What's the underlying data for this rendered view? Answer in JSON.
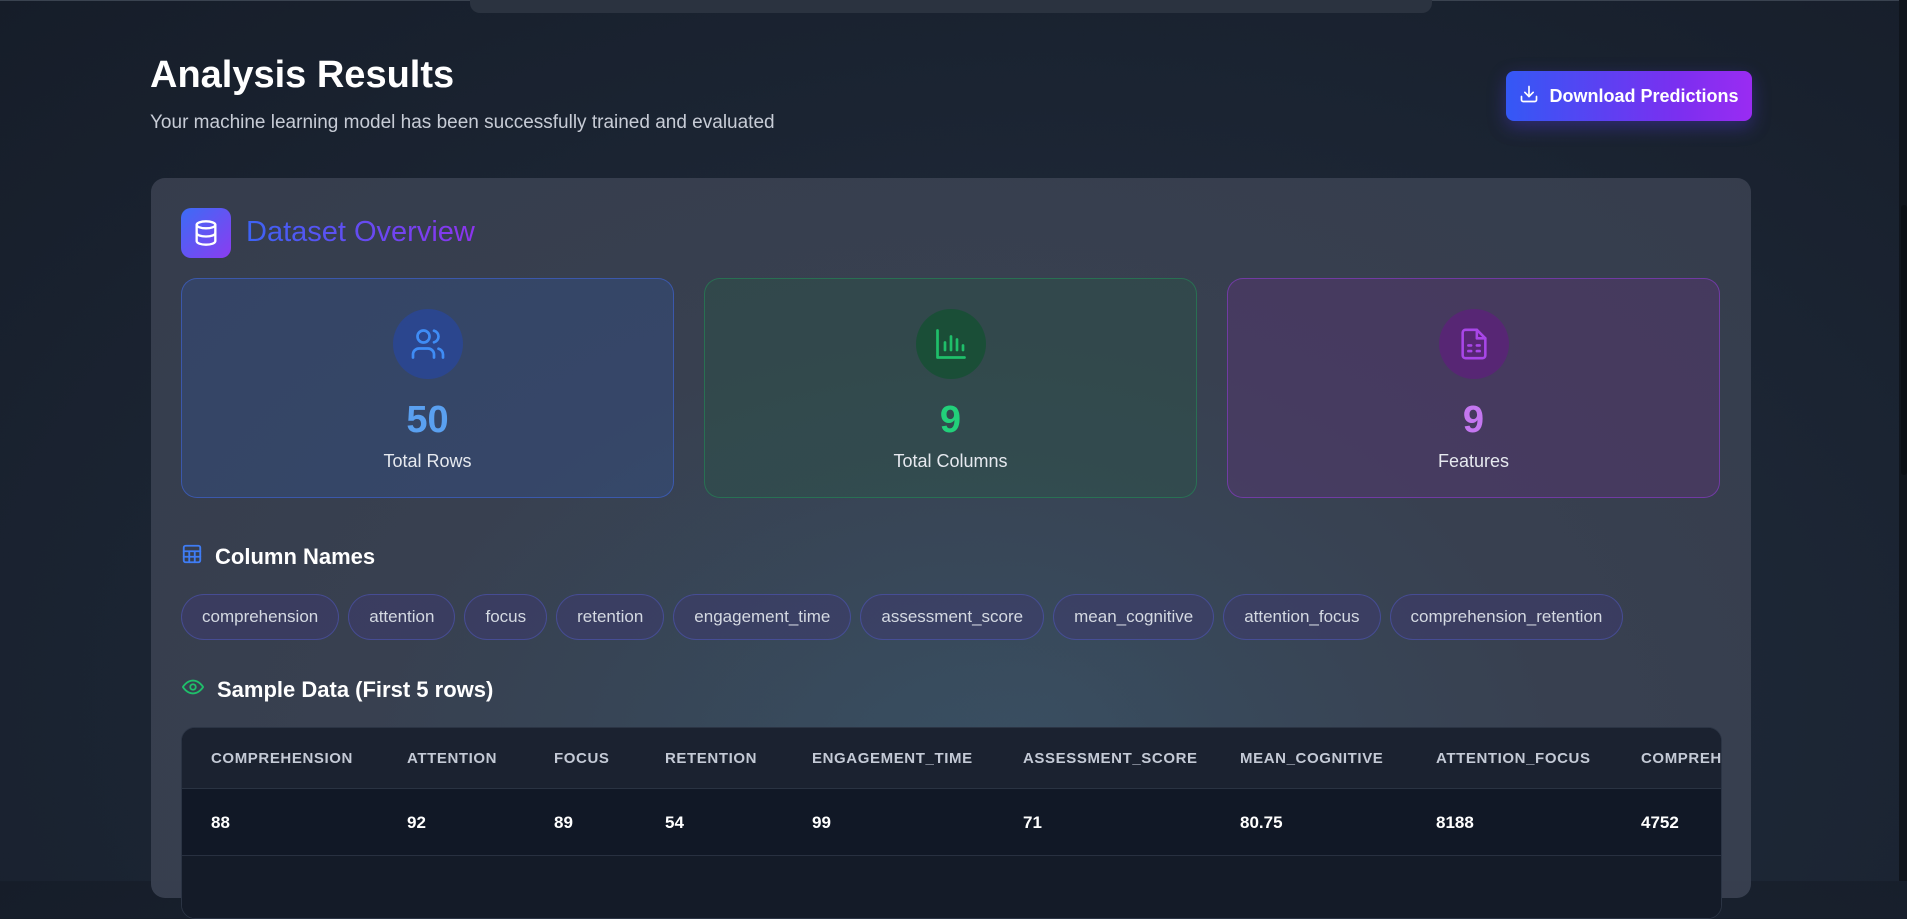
{
  "header": {
    "title": "Analysis Results",
    "subtitle": "Your machine learning model has been successfully trained and evaluated",
    "download_label": "Download Predictions"
  },
  "overview": {
    "title": "Dataset Overview",
    "stats": [
      {
        "value": "50",
        "label": "Total Rows",
        "icon": "users-icon",
        "color": "#5aa0f0"
      },
      {
        "value": "9",
        "label": "Total Columns",
        "icon": "bar-chart-icon",
        "color": "#22d07a"
      },
      {
        "value": "9",
        "label": "Features",
        "icon": "file-spreadsheet-icon",
        "color": "#c477f0"
      }
    ]
  },
  "columns": {
    "heading": "Column Names",
    "names": [
      "comprehension",
      "attention",
      "focus",
      "retention",
      "engagement_time",
      "assessment_score",
      "mean_cognitive",
      "attention_focus",
      "comprehension_retention"
    ]
  },
  "sample": {
    "heading": "Sample Data (First 5 rows)",
    "headers": [
      "COMPREHENSION",
      "ATTENTION",
      "FOCUS",
      "RETENTION",
      "ENGAGEMENT_TIME",
      "ASSESSMENT_SCORE",
      "MEAN_COGNITIVE",
      "ATTENTION_FOCUS",
      "COMPREHENSION_RETENTION"
    ],
    "rows": [
      [
        "88",
        "92",
        "89",
        "54",
        "99",
        "71",
        "80.75",
        "8188",
        "4752"
      ]
    ]
  },
  "colors": {
    "accent_start": "#3458f5",
    "accent_end": "#9a2cf2",
    "blue": "#5aa0f0",
    "green": "#22d07a",
    "purple": "#c477f0"
  }
}
